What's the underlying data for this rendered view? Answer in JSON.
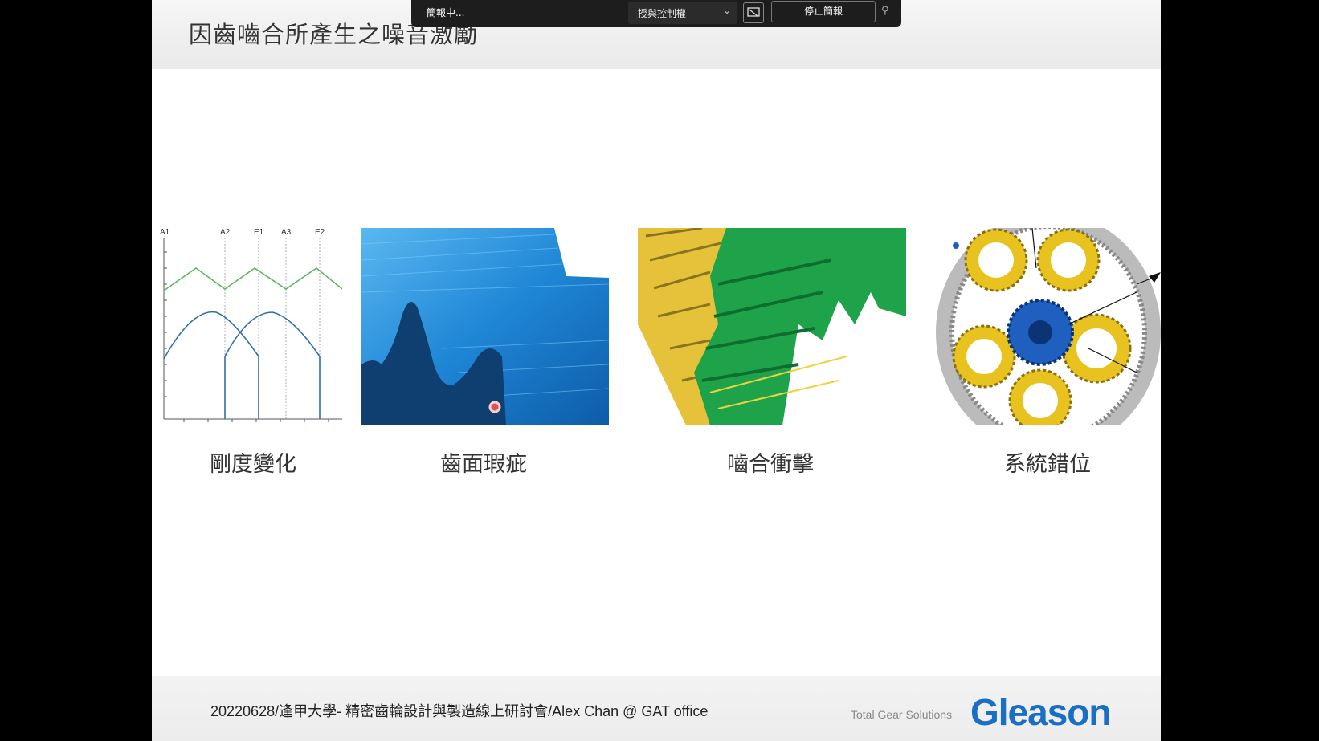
{
  "toolbar": {
    "status": "簡報中...",
    "control_label": "授與控制權",
    "stop_label": "停止簡報",
    "icons": {
      "chevron": "chevron-down-icon",
      "screen": "screen-share-icon",
      "pin": "pin-icon"
    }
  },
  "slide": {
    "title": "因齒嚙合所產生之噪音激勵",
    "panels": [
      {
        "caption": "剛度變化",
        "image": "stiffness-variation-chart",
        "markers": [
          "A1",
          "A2",
          "E1",
          "A3",
          "E2"
        ]
      },
      {
        "caption": "齒面瑕疵",
        "image": "tooth-flank-defect-render"
      },
      {
        "caption": "嚙合衝擊",
        "image": "meshing-impact-render"
      },
      {
        "caption": "系統錯位",
        "image": "planetary-gear-misalignment-render"
      }
    ],
    "footer": {
      "text": "20220628/逢甲大學- 精密齒輪設計與製造線上研討會/Alex Chan @ GAT office",
      "tagline": "Total Gear Solutions",
      "logo": "Gleason"
    }
  },
  "colors": {
    "logo": "#1a6fc4",
    "green_curve": "#5cb85c",
    "blue_curve": "#2f6fa8",
    "toolbar": "#1d1d1d"
  }
}
